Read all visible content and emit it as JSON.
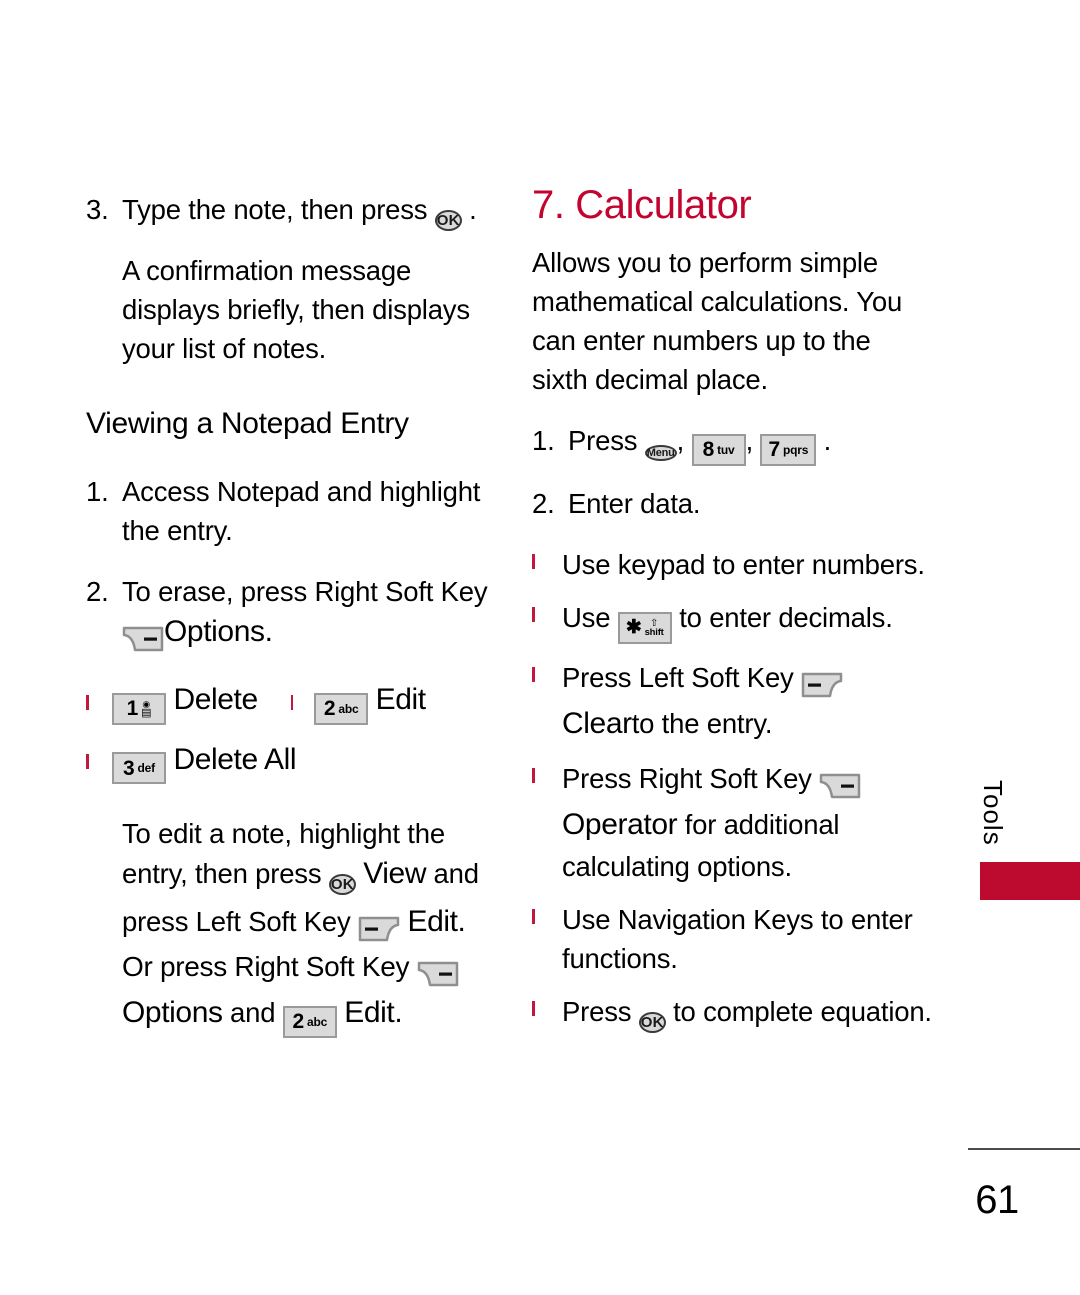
{
  "page": {
    "number": "61",
    "side_tab": "Tools"
  },
  "left_column": {
    "step3": {
      "num": "3.",
      "text_before": "Type the note, then press",
      "key": "ok-key",
      "text_after": "."
    },
    "step3_detail": "A confirmation message displays briefly, then displays your list of notes.",
    "heading": "Viewing a Notepad Entry",
    "step1": {
      "num": "1.",
      "text": "Access Notepad and highlight the entry."
    },
    "step2": {
      "num": "2.",
      "text": "To erase, press Right Soft Key",
      "softkey": "right-soft-key",
      "label": "Options."
    },
    "options": [
      {
        "key_digit": "1",
        "key_sub": "voicemail",
        "label": "Delete"
      },
      {
        "key_digit": "2",
        "key_sub": "abc",
        "label": "Edit"
      },
      {
        "key_digit": "3",
        "key_sub": "def",
        "label": "Delete All"
      }
    ],
    "edit_note": {
      "line1": "To edit a note, highlight the",
      "line2_pre": "entry, then press",
      "line2_key": "ok-key",
      "line2_cmd": "View",
      "line3_pre": "and press Left Soft Key",
      "line3_softkey": "left-soft-key",
      "line4_cmd": "Edit.",
      "line4_post": "Or press Right Soft Key",
      "line5_softkey": "right-soft-key",
      "line5_cmd": "Options",
      "line5_mid": "and",
      "line5_key_digit": "2",
      "line5_key_sub": "abc",
      "line5_cmd2": "Edit."
    }
  },
  "right_column": {
    "heading": "7. Calculator",
    "intro": "Allows you to perform simple mathematical calculations. You can enter numbers up to the sixth decimal place.",
    "step1": {
      "num": "1.",
      "text": "Press",
      "keys": [
        {
          "type": "round",
          "label": "Menu"
        },
        {
          "type": "rect",
          "digit": "8",
          "sub": "tuv"
        },
        {
          "type": "rect",
          "digit": "7",
          "sub": "pqrs"
        }
      ],
      "comma": ",",
      "period": "."
    },
    "step2": {
      "num": "2.",
      "text": "Enter data."
    },
    "bullets": [
      {
        "id": "keypad-numbers",
        "text": "Use keypad to enter numbers."
      },
      {
        "id": "shift-decimals",
        "pre": "Use",
        "key": "star-shift-key",
        "post": "to enter decimals."
      },
      {
        "id": "left-softkey-clear",
        "pre": "Press Left Soft Key",
        "softkey": "left-soft-key",
        "cmd": "Clear",
        "post": "to the entry."
      },
      {
        "id": "right-softkey-operator",
        "pre": "Press Right Soft Key",
        "softkey": "right-soft-key",
        "cmd": "Operator",
        "post": "for additional calculating options."
      },
      {
        "id": "navigation-keys",
        "text": "Use Navigation Keys to enter functions."
      },
      {
        "id": "ok-complete",
        "pre": "Press",
        "key": "ok-key",
        "post": "to complete equation."
      }
    ]
  },
  "colors": {
    "heading_red": "#C20430",
    "bullet_red": "#C2183F",
    "side_bar_red": "#BD0A2F",
    "key_face": "#DADADA",
    "key_border": "#9A9A9A"
  }
}
